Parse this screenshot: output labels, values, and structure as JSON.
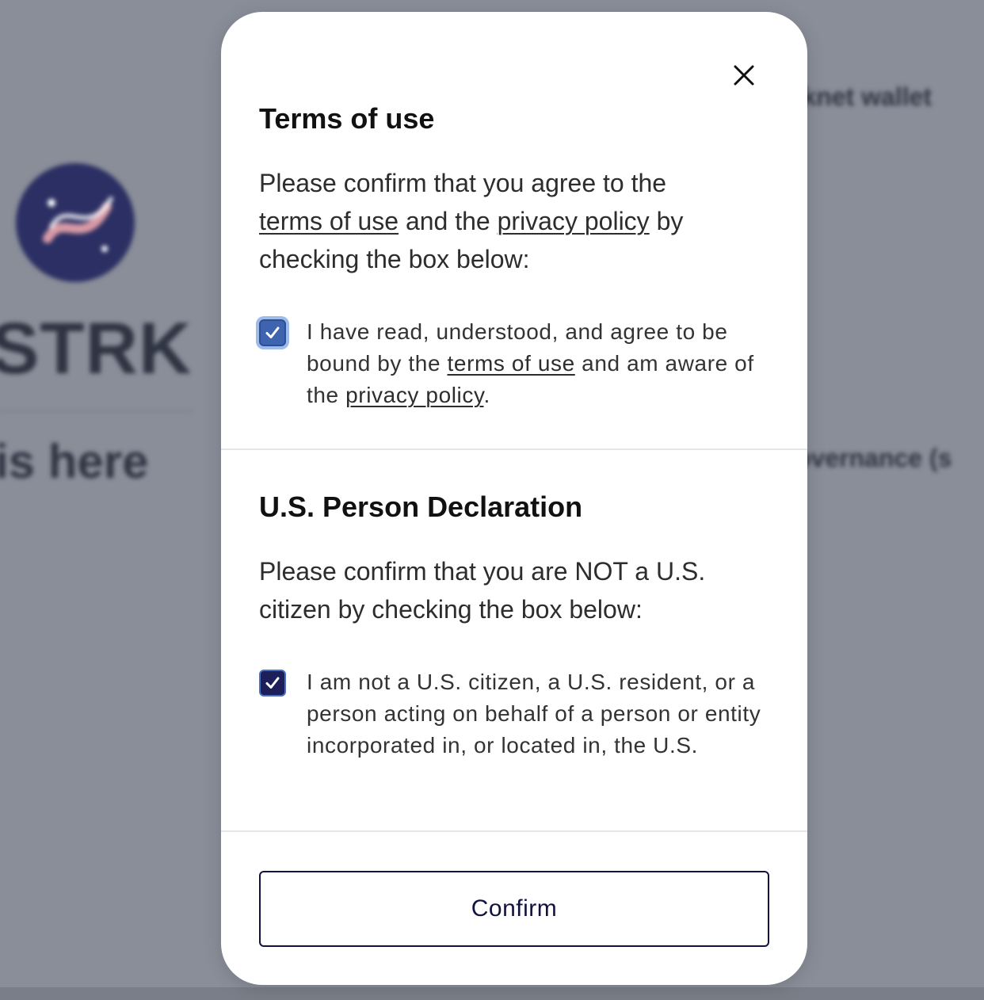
{
  "background": {
    "ticker": "STRK",
    "headline": "is here",
    "wallet_text": "rknet wallet",
    "governance_text": "overnance (s"
  },
  "modal": {
    "close_icon": "close-icon",
    "terms": {
      "title": "Terms of use",
      "prompt_before": "Please confirm that you agree to the",
      "prompt_link_terms": "terms of use",
      "prompt_middle": "and the",
      "prompt_link_privacy": "privacy policy",
      "prompt_after": "by checking the box below:",
      "checkbox_checked": true,
      "checkbox_text_before": "I have read, understood, and agree to be bound by the",
      "checkbox_link_terms": "terms of use",
      "checkbox_text_middle": "and am aware of the",
      "checkbox_link_privacy": "privacy policy",
      "checkbox_text_after": "."
    },
    "us_person": {
      "title": "U.S. Person Declaration",
      "prompt": "Please confirm that you are NOT a U.S. citizen by checking the box below:",
      "checkbox_checked": true,
      "checkbox_text": "I am not a U.S. citizen, a U.S. resident, or a person acting on behalf of a person or entity incorporated in, or located in, the U.S."
    },
    "confirm_label": "Confirm"
  },
  "colors": {
    "overlay": "#8a8e99",
    "modal_bg": "#ffffff",
    "checkbox_focused": "#3e64b0",
    "checkbox_dark": "#1c1f5a",
    "button_border": "#121240"
  }
}
